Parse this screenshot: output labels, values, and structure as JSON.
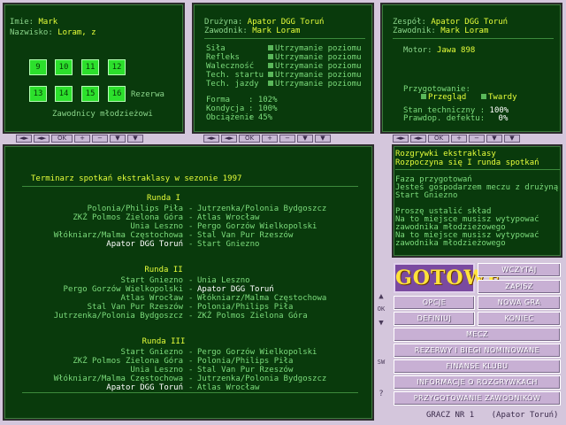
{
  "panel_player": {
    "imie_label": "Imie:",
    "imie_value": "Mark",
    "nazwisko_label": "Nazwisko:",
    "nazwisko_value": "Loram, z",
    "squares": [
      "9",
      "10",
      "11",
      "12",
      "13",
      "14",
      "15",
      "16"
    ],
    "rezerwa": "Rezerwa",
    "zawodnicy": "Zawodnicy młodzieżowi"
  },
  "panel_stats": {
    "druzyna_label": "Drużyna:",
    "druzyna_value": "Apator DGG Toruń",
    "zawodnik_label": "Zawodnik:",
    "zawodnik_value": "Mark Loram",
    "skills": [
      {
        "name": "Siła",
        "option": "Utrzymanie poziomu"
      },
      {
        "name": "Refleks",
        "option": "Utrzymanie poziomu"
      },
      {
        "name": "Waleczność",
        "option": "Utrzymanie poziomu"
      },
      {
        "name": "Tech. startu",
        "option": "Utrzymanie poziomu"
      },
      {
        "name": "Tech. jazdy",
        "option": "Utrzymanie poziomu"
      }
    ],
    "forma_label": "Forma",
    "forma_value": ": 102%",
    "kondycja_label": "Kondycja",
    "kondycja_value": ": 100%",
    "obciazenie_label": "Obciążenie",
    "obciazenie_value": ": 45%"
  },
  "panel_team": {
    "zespol_label": "Zespół:",
    "zespol_value": "Apator DGG Toruń",
    "zawodnik_label": "Zawodnik:",
    "zawodnik_value": "Mark Loram",
    "motor_label": "Motor:",
    "motor_value": "Jawa 898",
    "przygotowanie": "Przygotowanie:",
    "przeglad": "Przegląd",
    "twardy": "Twardy",
    "stan_label": "Stan techniczny :",
    "stan_value": "100%",
    "prawd_label": "Prawdop. defektu:",
    "prawd_value": "0%"
  },
  "toolbar": {
    "buttons": [
      "◄►",
      "◄►",
      "OK",
      "+",
      "−",
      "▼",
      "▼"
    ]
  },
  "schedule": {
    "title": "Terminarz spotkań ekstraklasy w sezonie 1997",
    "rounds": [
      {
        "title": "Runda I",
        "matches": [
          {
            "home": "Polonia/Philips Piła",
            "away": "Jutrzenka/Polonia Bydgoszcz",
            "highlight": false
          },
          {
            "home": "ZKŻ Polmos Zielona Góra",
            "away": "Atlas Wrocław",
            "highlight": false
          },
          {
            "home": "Unia Leszno",
            "away": "Pergo Gorzów Wielkopolski",
            "highlight": false
          },
          {
            "home": "Włókniarz/Malma Częstochowa",
            "away": "Stal Van Pur Rzeszów",
            "highlight": false
          },
          {
            "home": "Apator DGG Toruń",
            "away": "Start Gniezno",
            "highlight": "home"
          }
        ]
      },
      {
        "title": "Runda II",
        "matches": [
          {
            "home": "Start Gniezno",
            "away": "Unia Leszno",
            "highlight": false
          },
          {
            "home": "Pergo Gorzów Wielkopolski",
            "away": "Apator DGG Toruń",
            "highlight": "away"
          },
          {
            "home": "Atlas Wrocław",
            "away": "Włókniarz/Malma Częstochowa",
            "highlight": false
          },
          {
            "home": "Stal Van Pur Rzeszów",
            "away": "Polonia/Philips Piła",
            "highlight": false
          },
          {
            "home": "Jutrzenka/Polonia Bydgoszcz",
            "away": "ZKŻ Polmos Zielona Góra",
            "highlight": false
          }
        ]
      },
      {
        "title": "Runda III",
        "matches": [
          {
            "home": "Start Gniezno",
            "away": "Pergo Gorzów Wielkopolski",
            "highlight": false
          },
          {
            "home": "ZKŻ Polmos Zielona Góra",
            "away": "Polonia/Philips Piła",
            "highlight": false
          },
          {
            "home": "Unia Leszno",
            "away": "Stal Van Pur Rzeszów",
            "highlight": false
          },
          {
            "home": "Włókniarz/Malma Częstochowa",
            "away": "Jutrzenka/Polonia Bydgoszcz",
            "highlight": false
          },
          {
            "home": "Apator DGG Toruń",
            "away": "Atlas Wrocław",
            "highlight": "home"
          }
        ]
      }
    ]
  },
  "messages": {
    "title": "Rozgrywki ekstraklasy",
    "subtitle": "Rozpoczyna się I runda spotkań",
    "lines": [
      "Faza przygotowań",
      "Jesteś gospodarzem meczu z drużyną",
      "Start Gniezno",
      "",
      "Proszę ustalić skład",
      "Na to miejsce musisz wytypować",
      "zawodnika młodzieżowego",
      "Na to miejsce musisz wytypować",
      "zawodnika młodzieżowego"
    ]
  },
  "menu": {
    "gotowe": "GOTOWE",
    "wczytaj": "WCZYTAJ",
    "zapisz": "ZAPISZ",
    "opcje": "OPCJE",
    "nowa_gra": "NOWA GRA",
    "definiuj": "DEFINIUJ",
    "koniec": "KONIEC",
    "mecz": "MECZ",
    "rezerwy": "REZERWY I BIEGI NOMINOWANE",
    "finanse": "FINANSE KLUBU",
    "informacje": "INFORMACJE O ROZGRYWKACH",
    "przygotowanie": "PRZYGOTOWANIE ZAWODNIKÓW"
  },
  "status": {
    "gracz": "GRACZ NR 1",
    "team": "(Apator Toruń)"
  },
  "side_tools": [
    "▲",
    "OK",
    "▼",
    "SW",
    "?"
  ]
}
